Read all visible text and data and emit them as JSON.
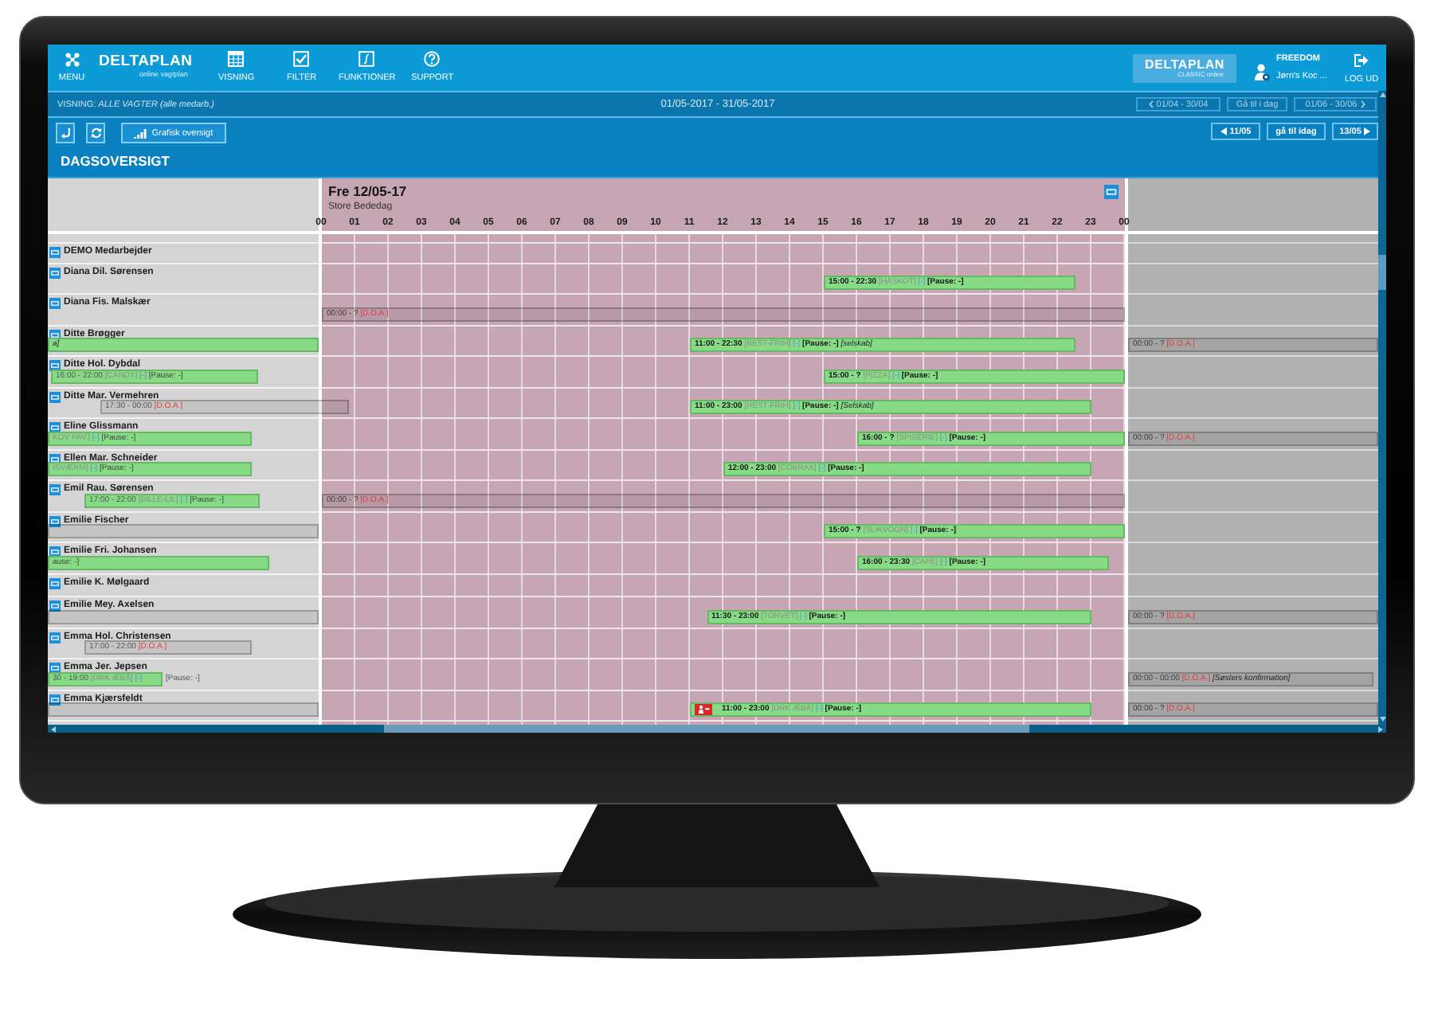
{
  "topbar": {
    "menu": "MENU",
    "logo": {
      "name": "DELTAPLAN",
      "tagline": "online vagtplan"
    },
    "nav": [
      "VISNING",
      "FILTER",
      "FUNKTIONER",
      "SUPPORT"
    ],
    "brand": {
      "name": "DELTAPLAN",
      "tagline": "CLASSIC online"
    },
    "user": {
      "company": "FREEDOM",
      "name": "Jørn's Koc ..."
    },
    "logout": "LOG UD"
  },
  "viewbar": {
    "view": "VISNING: *ALLE VAGTER (alle medarb.)*",
    "period": "01/05-2017 - 31/05-2017",
    "prev_month": "01/04 - 30/04",
    "today": "Gå til i dag",
    "next_month": "01/06 - 30/06"
  },
  "toolbar": {
    "graph_button": "Grafisk oversigt",
    "prev_day": "11/05",
    "today": "gå til idag",
    "next_day": "13/05"
  },
  "section_title": "DAGSOVERSIGT",
  "schedule": {
    "day": "Fre 12/05-17",
    "holiday": "Store Bededag",
    "hours": [
      "00",
      "01",
      "02",
      "03",
      "04",
      "05",
      "06",
      "07",
      "08",
      "09",
      "10",
      "11",
      "12",
      "13",
      "14",
      "15",
      "16",
      "17",
      "18",
      "19",
      "20",
      "21",
      "22",
      "23",
      "00"
    ],
    "rows": [
      {
        "name": "DEMO Medarbejder"
      },
      {
        "name": "Diana Dil. Sørensen",
        "current": [
          {
            "kind": "shift",
            "time": "15:00 - 22:30",
            "code": "[HASKOT]",
            "flag": "[-]",
            "pause": "[Pause: -]",
            "alert": false
          }
        ]
      },
      {
        "name": "Diana Fis. Malskær",
        "current": [
          {
            "kind": "absence",
            "time": "00:00 - ?",
            "code": "[D.O.A.]"
          }
        ]
      },
      {
        "name": "Ditte Brøgger",
        "previous": [
          {
            "kind": "shift",
            "note": "a]"
          }
        ],
        "current": [
          {
            "kind": "shift",
            "time": "11:00 - 22:30",
            "code": "[REST-FRIH]",
            "flag": "[-]",
            "pause": "[Pause: -]",
            "note": "[selskab]",
            "alert": false
          }
        ],
        "next": [
          {
            "kind": "absence",
            "time": "00:00 - ?",
            "code": "[D.O.A.]"
          }
        ]
      },
      {
        "name": "Ditte Hol. Dybdal",
        "previous": [
          {
            "kind": "shift",
            "time": "16:00 - 22:00",
            "code": "[CANDY]",
            "flag": "[-]",
            "pause": "[Pause: -]"
          }
        ],
        "current": [
          {
            "kind": "shift",
            "time": "15:00 - ?",
            "code": "[PIZZA]",
            "flag": "[-]",
            "pause": "[Pause: -]",
            "alert": false
          }
        ]
      },
      {
        "name": "Ditte Mar. Vermehren",
        "previous": [
          {
            "kind": "absence",
            "time": "17:30 - 00:00",
            "code": "[D.O.A.]"
          }
        ],
        "current": [
          {
            "kind": "shift",
            "time": "11:00 - 23:00",
            "code": "[REST-FRIH]",
            "flag": "[-]",
            "pause": "[Pause: -]",
            "note": "[Selskab]",
            "alert": false
          }
        ]
      },
      {
        "name": "Eline Glissmann",
        "previous": [
          {
            "kind": "shift",
            "code": "KOV PAV.]",
            "flag": "[-]",
            "pause": "[Pause: -]"
          }
        ],
        "current": [
          {
            "kind": "shift",
            "time": "16:00 - ?",
            "code": "[SPISERIE]",
            "flag": "[-]",
            "pause": "[Pause: -]",
            "alert": false
          }
        ],
        "next": [
          {
            "kind": "absence",
            "time": "00:00 - ?",
            "code": "[D.O.A.]"
          }
        ]
      },
      {
        "name": "Ellen Mar. Schneider",
        "previous": [
          {
            "kind": "shift",
            "code": "ISVÆRM]",
            "flag": "[-]",
            "pause": "[Pause: -]"
          }
        ],
        "current": [
          {
            "kind": "shift",
            "time": "12:00 - 23:00",
            "code": "[COBRAX]",
            "flag": "[-]",
            "pause": "[Pause: -]",
            "alert": false
          }
        ]
      },
      {
        "name": "Emil Rau. Sørensen",
        "previous": [
          {
            "kind": "shift",
            "time": "17:00 - 22:00",
            "code": "[BILLE-LIL]",
            "flag": "[-]",
            "pause": "[Pause: -]"
          }
        ],
        "current": [
          {
            "kind": "absence",
            "time": "00:00 - ?",
            "code": "[D.O.A.]"
          }
        ]
      },
      {
        "name": "Emilie Fischer",
        "previous": [
          {
            "kind": "blank"
          }
        ],
        "current": [
          {
            "kind": "shift",
            "time": "15:00 - ?",
            "code": "[SLIKVOGN]",
            "flag": "[-]",
            "pause": "[Pause: -]",
            "alert": false
          }
        ]
      },
      {
        "name": "Emilie Fri. Johansen",
        "previous": [
          {
            "kind": "shift",
            "pause": "ause: -]"
          }
        ],
        "current": [
          {
            "kind": "shift",
            "time": "16:00 - 23:30",
            "code": "[CAFÉ]",
            "flag": "[-]",
            "pause": "[Pause: -]",
            "alert": false
          }
        ]
      },
      {
        "name": "Emilie K. Mølgaard"
      },
      {
        "name": "Emilie Mey. Axelsen",
        "previous": [
          {
            "kind": "blank"
          }
        ],
        "current": [
          {
            "kind": "shift",
            "time": "11:30 - 23:00",
            "code": "[TORVET]",
            "flag": "[-]",
            "pause": "[Pause: -]",
            "alert": false
          }
        ],
        "next": [
          {
            "kind": "absence",
            "time": "00:00 - ?",
            "code": "[D.O.A.]"
          }
        ]
      },
      {
        "name": "Emma Hol. Christensen",
        "previous": [
          {
            "kind": "absence",
            "time": "17:00 - 22:00",
            "code": "[D.O.A.]"
          }
        ]
      },
      {
        "name": "Emma Jer. Jepsen",
        "previous": [
          {
            "kind": "shift",
            "time": "30 - 19:00",
            "code": "[DRK ÆBÅ]",
            "flag": "[-]",
            "pause": "[Pause: -]"
          }
        ],
        "next": [
          {
            "kind": "absence",
            "time": "00:00 - 00:00",
            "code": "[D.O.A.]",
            "note": "[Søsters konfirmation]"
          }
        ]
      },
      {
        "name": "Emma Kjærsfeldt",
        "previous": [
          {
            "kind": "blank"
          }
        ],
        "current": [
          {
            "kind": "shift",
            "time": "11:00 - 23:00",
            "code": "[DRK ÆBÅ]",
            "flag": "[-]",
            "pause": "[Pause: -]",
            "alert": true
          }
        ],
        "next": [
          {
            "kind": "absence",
            "time": "00:00 - ?",
            "code": "[D.O.A.]"
          }
        ]
      }
    ]
  }
}
